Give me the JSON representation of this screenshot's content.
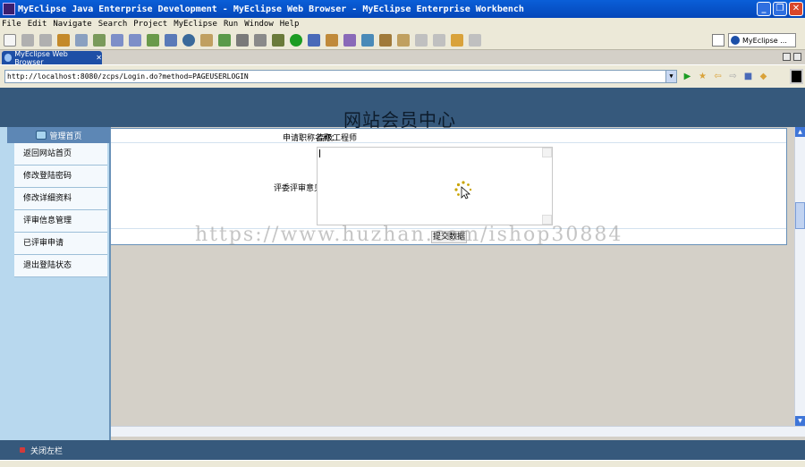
{
  "window": {
    "title": "MyEclipse Java Enterprise Development - MyEclipse Web Browser - MyEclipse Enterprise Workbench",
    "minimize": "_",
    "maximize": "❐",
    "close": "✕"
  },
  "menu": [
    "File",
    "Edit",
    "Navigate",
    "Search",
    "Project",
    "MyEclipse",
    "Run",
    "Window",
    "Help"
  ],
  "perspective": {
    "label": "MyEclipse ..."
  },
  "editor_tab": {
    "label": "MyEclipse Web Browser",
    "close": "✕"
  },
  "address": {
    "url": "http://localhost:8080/zcps/Login.do?method=PAGEUSERLOGIN",
    "dropdown": "▼",
    "go": "▶",
    "back": "⇦",
    "forward": "⇨"
  },
  "page": {
    "site_title": "网站会员中心",
    "sidebar_header": "管理首页",
    "sidebar_items": [
      "返回网站首页",
      "修改登陆密码",
      "修改详细资料",
      "评审信息管理",
      "已评审申请",
      "退出登陆状态"
    ],
    "form": {
      "job_title_label": "申请职称名称：",
      "job_title_value": "高级工程师",
      "review_label": "评委评审意见：",
      "submit_label": "提交数据"
    },
    "footer_label": "关闭左栏",
    "watermark": "https://www.huzhan.com/ishop30884"
  },
  "colors": {
    "titlebar": "#0a5fd8",
    "header": "#36597c",
    "sidebar": "#b8d8ee"
  }
}
